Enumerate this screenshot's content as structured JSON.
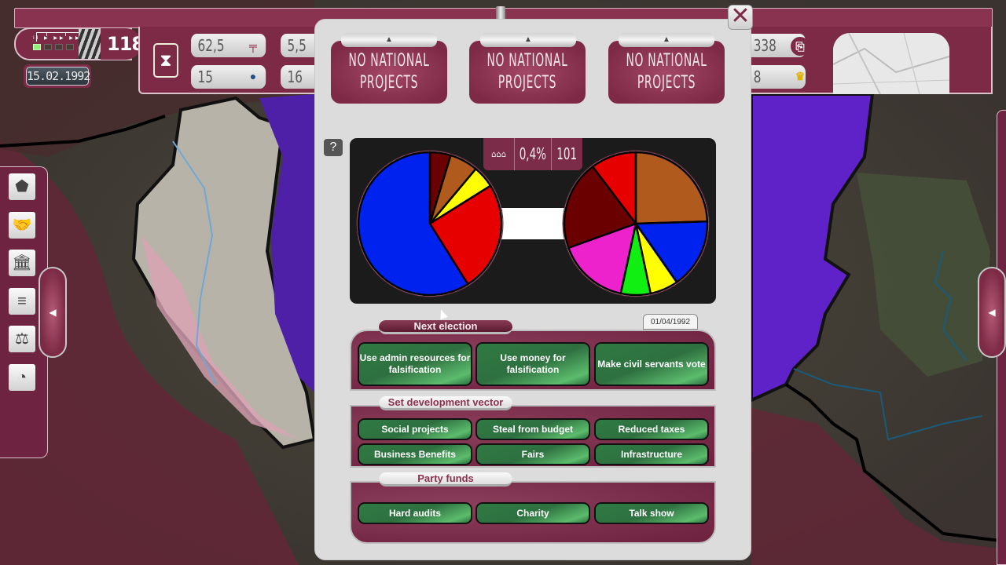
{
  "topbar": {
    "speed": {
      "labels": [
        "II",
        "▶",
        "▶▶",
        "▶▶▶"
      ],
      "active_index": 0
    },
    "turn_count": "118",
    "date": "15.02.1992",
    "stats": [
      {
        "value": "62,5",
        "icon": "gavel-icon",
        "glyph": "╤"
      },
      {
        "value": "15",
        "icon": "person-icon",
        "glyph": "●"
      },
      {
        "value": "5,5"
      },
      {
        "value": "16"
      },
      {
        "value": "338",
        "icon": "ballot-icon",
        "glyph": "⎘"
      },
      {
        "value": "8",
        "icon": "leader-icon",
        "glyph": "♛"
      }
    ]
  },
  "left_sidebar": {
    "items": [
      {
        "name": "party-shield",
        "glyph": "⬟"
      },
      {
        "name": "handshake",
        "glyph": "🤝"
      },
      {
        "name": "government-building",
        "glyph": "🏛"
      },
      {
        "name": "menu",
        "glyph": "≡"
      },
      {
        "name": "justice-scales",
        "glyph": "⚖"
      },
      {
        "name": "pie-chart",
        "glyph": "◔"
      }
    ],
    "toggle_glyph": "◀"
  },
  "right_sidebar": {
    "toggle_glyph": "◀"
  },
  "dialog": {
    "close_glyph": "✕",
    "national_projects": [
      {
        "line1": "NO NATIONAL",
        "line2": "PROJECTS",
        "tab_glyph": "▲"
      },
      {
        "line1": "NO NATIONAL",
        "line2": "PROJECTS",
        "tab_glyph": "▲"
      },
      {
        "line1": "NO NATIONAL",
        "line2": "PROJECTS",
        "tab_glyph": "▲"
      }
    ],
    "help_glyph": "?",
    "poll": {
      "percent": "0,4%",
      "count": "101"
    },
    "next_election": {
      "label": "Next election",
      "date": "01/04/1992",
      "buttons": [
        "Use admin resources for falsification",
        "Use money for falsification",
        "Make civil servants vote"
      ]
    },
    "development_vector": {
      "label": "Set development vector",
      "buttons": [
        "Social projects",
        "Steal from budget",
        "Reduced taxes",
        "Business Benefits",
        "Fairs",
        "Infrastructure"
      ]
    },
    "party_funds": {
      "label": "Party funds",
      "buttons": [
        "Hard audits",
        "Charity",
        "Talk show"
      ]
    }
  },
  "chart_data": [
    {
      "type": "pie",
      "title": "",
      "slices": [
        {
          "color": "#6b0000",
          "value": 4.7
        },
        {
          "color": "#b05a1e",
          "value": 6.4
        },
        {
          "color": "#ffff00",
          "value": 5.0
        },
        {
          "color": "#e60000",
          "value": 25.0
        },
        {
          "color": "#0022ee",
          "value": 58.9
        }
      ]
    },
    {
      "type": "pie",
      "title": "",
      "slices": [
        {
          "color": "#b05a1e",
          "value": 24.5
        },
        {
          "color": "#0022ee",
          "value": 15.8
        },
        {
          "color": "#ffff00",
          "value": 6.4
        },
        {
          "color": "#11ee11",
          "value": 6.7
        },
        {
          "color": "#ee22cc",
          "value": 16.1
        },
        {
          "color": "#6b0000",
          "value": 20.2
        },
        {
          "color": "#e60000",
          "value": 10.3
        }
      ]
    }
  ]
}
